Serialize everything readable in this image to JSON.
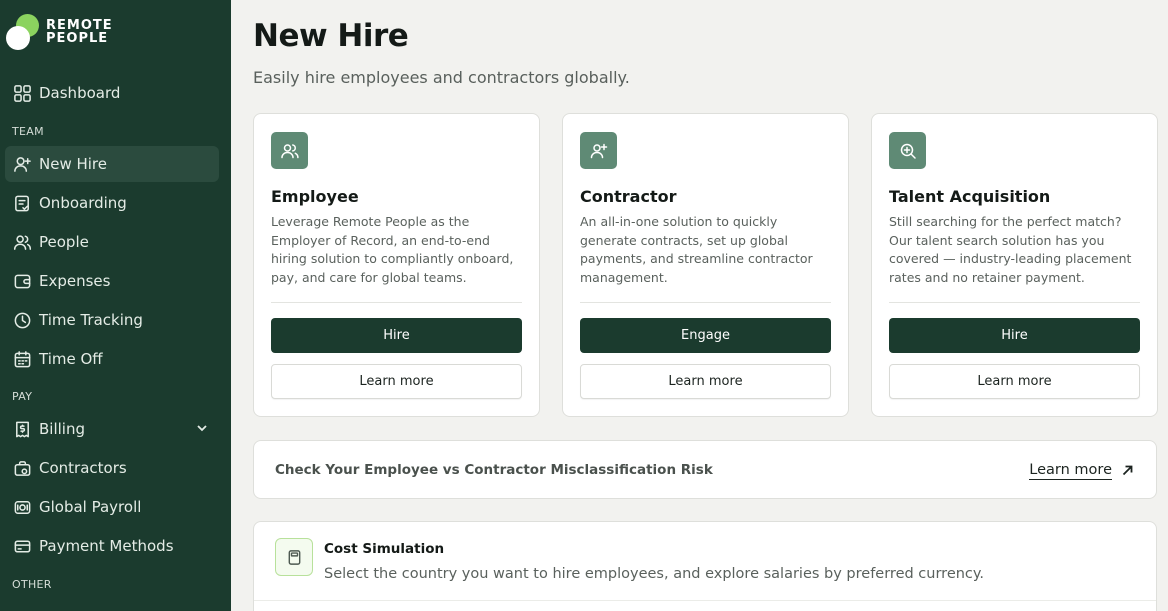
{
  "brand": {
    "line1": "REMOTE",
    "line2": "PEOPLE",
    "accent": "#8bd35f",
    "sidebar_bg": "#1b3b2e"
  },
  "sidebar": {
    "dashboard": {
      "label": "Dashboard",
      "icon": "grid-icon"
    },
    "sections": [
      {
        "label": "TEAM"
      },
      {
        "label": "PAY"
      },
      {
        "label": "OTHER"
      }
    ],
    "items": [
      {
        "label": "New Hire",
        "icon": "user-plus-icon",
        "active": true
      },
      {
        "label": "Onboarding",
        "icon": "checklist-icon"
      },
      {
        "label": "People",
        "icon": "users-icon"
      },
      {
        "label": "Expenses",
        "icon": "wallet-icon"
      },
      {
        "label": "Time Tracking",
        "icon": "clock-icon"
      },
      {
        "label": "Time Off",
        "icon": "calendar-icon"
      },
      {
        "label": "Billing",
        "icon": "invoice-icon",
        "expandable": true
      },
      {
        "label": "Contractors",
        "icon": "briefcase-icon"
      },
      {
        "label": "Global Payroll",
        "icon": "payroll-icon"
      },
      {
        "label": "Payment Methods",
        "icon": "credit-card-icon"
      }
    ]
  },
  "header": {
    "title": "New Hire",
    "subtitle": "Easily hire employees and contractors globally."
  },
  "cards": [
    {
      "title": "Employee",
      "icon": "users-icon",
      "description": "Leverage Remote People as the Employer of Record, an end-to-end hiring solution to compliantly onboard, pay, and care for global teams.",
      "primary_label": "Hire",
      "secondary_label": "Learn more"
    },
    {
      "title": "Contractor",
      "icon": "user-plus-icon",
      "description": "An all-in-one solution to quickly generate contracts, set up global payments, and streamline contractor management.",
      "primary_label": "Engage",
      "secondary_label": "Learn more"
    },
    {
      "title": "Talent Acquisition",
      "icon": "search-plus-icon",
      "description": "Still searching for the perfect match? Our talent search solution has you covered — industry-leading placement rates and no retainer payment.",
      "primary_label": "Hire",
      "secondary_label": "Learn more"
    }
  ],
  "risk": {
    "label": "Check Your Employee vs Contractor Misclassification Risk",
    "link": "Learn more",
    "icon": "arrow-up-right-icon"
  },
  "cost_simulation": {
    "title": "Cost Simulation",
    "description": "Select the country you want to hire employees, and explore salaries by preferred currency.",
    "icon": "calculator-icon"
  }
}
